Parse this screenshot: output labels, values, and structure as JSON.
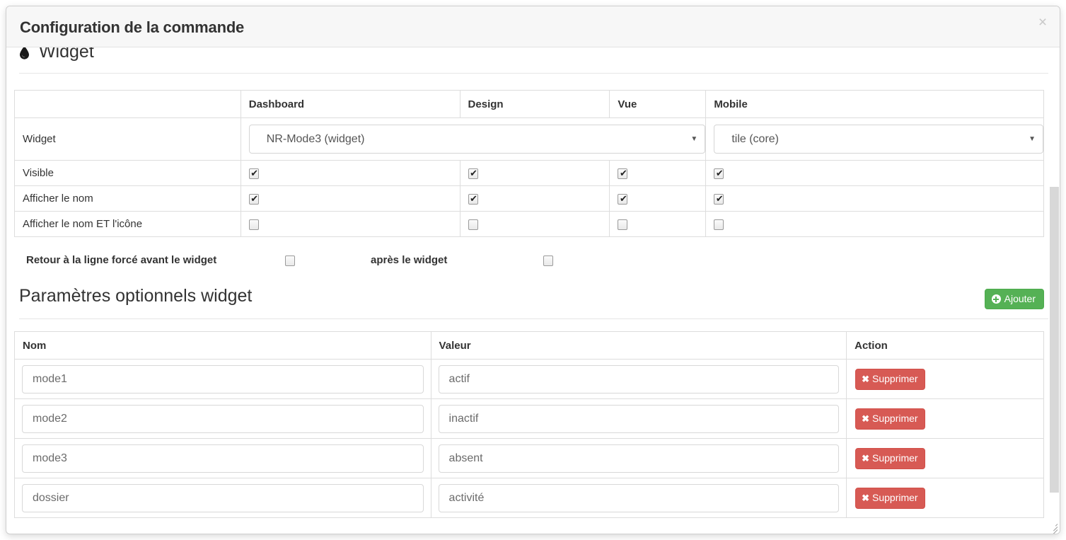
{
  "modal": {
    "title": "Configuration de la commande",
    "close_label": "×"
  },
  "widget_section": {
    "heading": "Widget",
    "icon": "tint-icon",
    "columns": [
      "",
      "Dashboard",
      "Design",
      "Vue",
      "Mobile"
    ],
    "selects": {
      "dashboard": {
        "value": "NR-Mode3 (widget)",
        "caret": "▼"
      },
      "mobile": {
        "value": "tile (core)",
        "caret": "▼"
      }
    },
    "rows": [
      {
        "label": "Visible",
        "dashboard": true,
        "design": true,
        "vue": true,
        "mobile": true
      },
      {
        "label": "Afficher le nom",
        "dashboard": true,
        "design": true,
        "vue": true,
        "mobile": true
      },
      {
        "label": "Afficher le nom ET l'icône",
        "dashboard": false,
        "design": false,
        "vue": false,
        "mobile": false
      }
    ],
    "widget_row_label": "Widget"
  },
  "line_break": {
    "before_label": "Retour à la ligne forcé avant le widget",
    "before_checked": false,
    "after_label": "après le widget",
    "after_checked": false
  },
  "params": {
    "heading": "Paramètres optionnels widget",
    "add_button": "Ajouter",
    "add_icon": "plus-circle-icon",
    "columns": [
      "Nom",
      "Valeur",
      "Action"
    ],
    "delete_label": "Supprimer",
    "delete_icon": "times-icon",
    "rows": [
      {
        "nom": "mode1",
        "valeur": "actif"
      },
      {
        "nom": "mode2",
        "valeur": "inactif"
      },
      {
        "nom": "mode3",
        "valeur": "absent"
      },
      {
        "nom": "dossier",
        "valeur": "activité"
      }
    ]
  },
  "colors": {
    "add_green": "#55b155",
    "delete_red": "#d75a54",
    "header_bg": "#f7f7f7",
    "border": "#dddddd"
  }
}
